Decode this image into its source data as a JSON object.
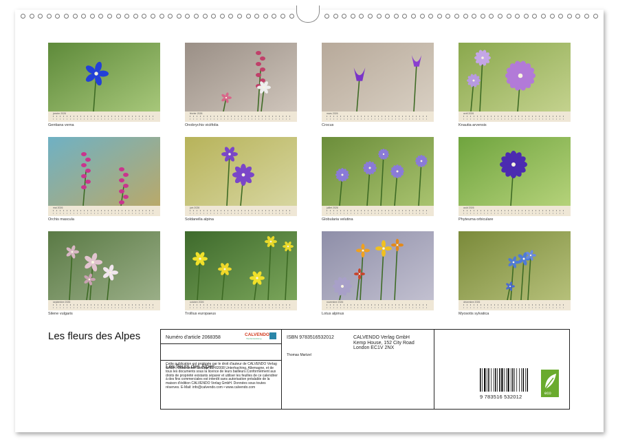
{
  "months": [
    {
      "name": "janvier 2026",
      "caption": "Gentiana verna"
    },
    {
      "name": "février 2026",
      "caption": "Onobrychis viciifolia"
    },
    {
      "name": "mars 2026",
      "caption": "Crocus"
    },
    {
      "name": "avril 2026",
      "caption": "Knautia arvensis"
    },
    {
      "name": "mai 2026",
      "caption": "Orchis mascula"
    },
    {
      "name": "juin 2026",
      "caption": "Soldanella alpina"
    },
    {
      "name": "juillet 2026",
      "caption": "Globularia velutina"
    },
    {
      "name": "août 2026",
      "caption": "Phyteuma orbiculare"
    },
    {
      "name": "septembre 2026",
      "caption": "Silene vulgaris"
    },
    {
      "name": "octobre 2026",
      "caption": "Trollius europaeus"
    },
    {
      "name": "novembre 2026",
      "caption": "Lotus alpinus"
    },
    {
      "name": "décembre 2026",
      "caption": "Myosotis sylvatica"
    }
  ],
  "title": "Les fleurs des Alpes",
  "info": {
    "article": "Numéro d'article 2068358",
    "brand": "CALVENDO",
    "brand_sub": "Titel Entwicklung",
    "subtitle": "Les fleurs des Alpes",
    "legal": "Cette publication est protégée par le droit d'auteur de CALVENDO Verlag GmbH, Ottobrunner Strasse 39, 82008 Unterhaching, Allemagne, et de tous les documents sous la licence de leurs bailleurs.Conformément aux droits de propriété existants séparer et utiliser les feuilles de ce calendrier à des fins commerciales est interdit sans autorisation préalable de la maison d'édition CALVENDO Verlag GmbH. Données sous toutes réserves. E-Mail: info@calvendo.com • www.calvendo.com",
    "isbn": "ISBN 9783516532012",
    "publisher_line1": "CALVENDO Verlag GmbH",
    "publisher_line2": "Kemp House, 152 City Road",
    "publisher_line3": "London EC1V 2NX",
    "author": "Thomas Martzel",
    "barcode_number": "9 783516 532012",
    "eco_label": "eco"
  },
  "colors": {
    "accent": "#d1391d",
    "calendar_strip": "#efe7d6",
    "eco_green": "#6aab2e"
  }
}
